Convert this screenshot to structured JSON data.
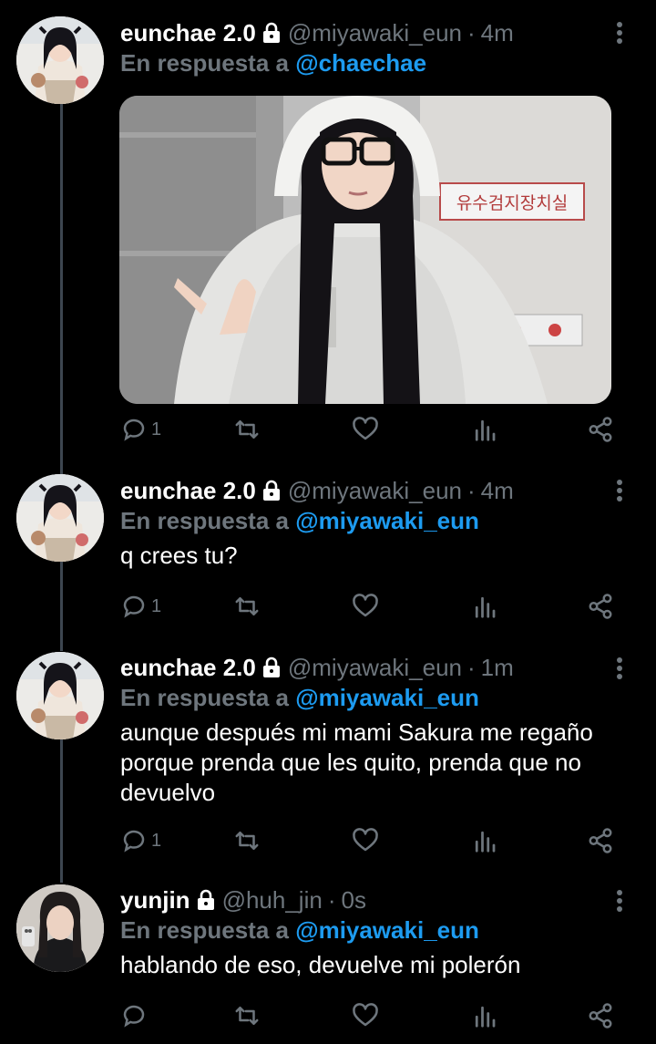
{
  "colors": {
    "background": "#000000",
    "link": "#1d9bf0",
    "muted": "#6e767d",
    "text": "#ffffff"
  },
  "tweets": [
    {
      "name": "eunchae 2.0",
      "handle": "@miyawaki_eun",
      "separator": "·",
      "time": "4m",
      "reply_prefix": "En respuesta a",
      "reply_to": "@chaechae",
      "text": "",
      "has_media": true,
      "media_sign_text": "유수검지장치실",
      "reply_count": "1",
      "protected": true
    },
    {
      "name": "eunchae 2.0",
      "handle": "@miyawaki_eun",
      "separator": "·",
      "time": "4m",
      "reply_prefix": "En respuesta a",
      "reply_to": "@miyawaki_eun",
      "text": "q crees tu?",
      "reply_count": "1",
      "protected": true
    },
    {
      "name": "eunchae 2.0",
      "handle": "@miyawaki_eun",
      "separator": "·",
      "time": "1m",
      "reply_prefix": "En respuesta a",
      "reply_to": "@miyawaki_eun",
      "text": "aunque después mi mami Sakura me regaño porque prenda que les quito, prenda que no devuelvo",
      "reply_count": "1",
      "protected": true
    },
    {
      "name": "yunjin",
      "handle": "@huh_jin",
      "separator": "·",
      "time": "0s",
      "reply_prefix": "En respuesta a",
      "reply_to": "@miyawaki_eun",
      "text": "hablando de eso, devuelve mi polerón",
      "reply_count": "",
      "protected": true
    }
  ],
  "icons": [
    "reply-icon",
    "retweet-icon",
    "like-icon",
    "analytics-icon",
    "share-icon",
    "lock-icon",
    "more-icon"
  ]
}
